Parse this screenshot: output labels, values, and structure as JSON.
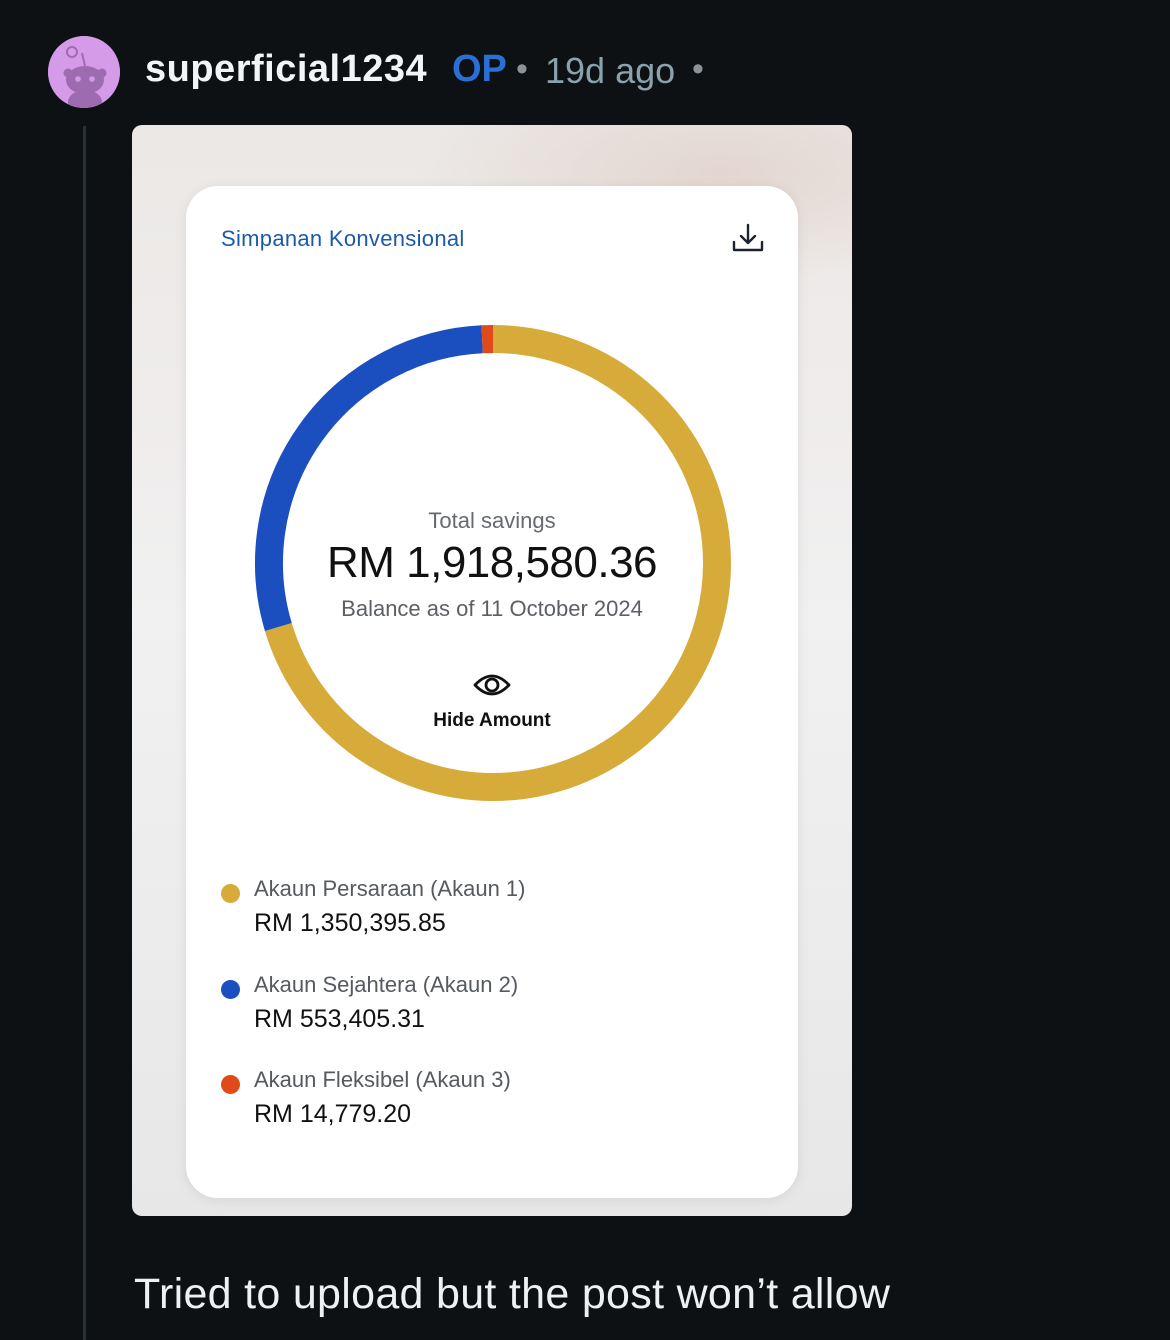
{
  "comment": {
    "username": "superficial1234",
    "op_badge": "OP",
    "separator": "•",
    "age": "19d ago",
    "text": "Tried to upload but the post won’t allow"
  },
  "card": {
    "title": "Simpanan Konvensional",
    "total_label": "Total savings",
    "total_amount": "RM 1,918,580.36",
    "balance_date": "Balance as of 11 October 2024",
    "hide_amount_label": "Hide Amount",
    "legend": [
      {
        "name": "Akaun Persaraan (Akaun 1)",
        "amount": "RM 1,350,395.85",
        "color": "#d6ab3a"
      },
      {
        "name": "Akaun Sejahtera (Akaun 2)",
        "amount": "RM 553,405.31",
        "color": "#1b4fc0"
      },
      {
        "name": "Akaun Fleksibel (Akaun 3)",
        "amount": "RM 14,779.20",
        "color": "#e04a1b"
      }
    ]
  },
  "chart_data": {
    "type": "pie",
    "categories": [
      "Akaun Persaraan (Akaun 1)",
      "Akaun Sejahtera (Akaun 2)",
      "Akaun Fleksibel (Akaun 3)"
    ],
    "values": [
      1350395.85,
      553405.31,
      14779.2
    ],
    "colors": [
      "#d6ab3a",
      "#1b4fc0",
      "#e04a1b"
    ],
    "title": ""
  },
  "colors": {
    "background": "#0d1114",
    "op_badge": "#2a6fd6",
    "card_title": "#1a5aa8"
  }
}
